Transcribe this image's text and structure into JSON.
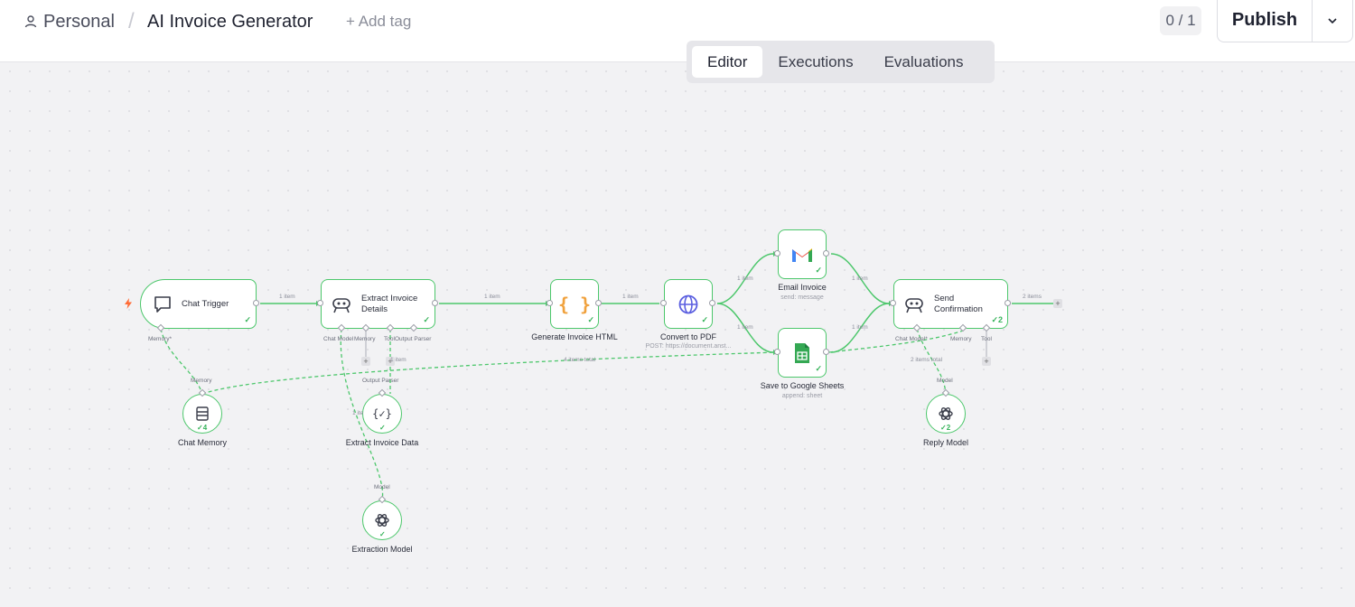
{
  "header": {
    "workspace": "Personal",
    "separator": "/",
    "workflow_name": "AI Invoice Generator",
    "add_tag": "+ Add tag",
    "counter": "0 / 1",
    "publish_label": "Publish"
  },
  "tabs": [
    {
      "label": "Editor",
      "active": true
    },
    {
      "label": "Executions",
      "active": false
    },
    {
      "label": "Evaluations",
      "active": false
    }
  ],
  "nodes": {
    "chat_trigger": {
      "title": "Chat Trigger"
    },
    "extract_invoice_details": {
      "title": "Extract Invoice Details",
      "line1": "Extract Invoice",
      "line2": "Details"
    },
    "generate_invoice_html": {
      "title": "Generate Invoice HTML"
    },
    "convert_to_pdf": {
      "title": "Convert to PDF",
      "subtitle": "POST: https://document.anst..."
    },
    "email_invoice": {
      "title": "Email Invoice",
      "subtitle": "send: message"
    },
    "save_to_google_sheets": {
      "title": "Save to Google Sheets",
      "subtitle": "append: sheet"
    },
    "send_confirmation": {
      "title": "Send Confirmation",
      "line1": "Send",
      "line2": "Confirmation",
      "badge": "2"
    },
    "chat_memory": {
      "title": "Chat Memory",
      "badge": "4"
    },
    "extract_invoice_data": {
      "title": "Extract Invoice Data"
    },
    "extraction_model": {
      "title": "Extraction Model"
    },
    "reply_model": {
      "title": "Reply Model",
      "badge": "2"
    }
  },
  "ports": {
    "memory_star": "Memory*",
    "chat_model": "Chat Model",
    "memory": "Memory",
    "tool": "Tool",
    "output_parser": "Output Parser",
    "chat_model_star": "Chat Model*",
    "memory2": "Memory",
    "tool2": "Tool",
    "in_memory": "Memory",
    "in_output_parser": "Output Parser",
    "in_model": "Model",
    "in_model2": "Model"
  },
  "edges": {
    "e1": "1 item",
    "e2": "1 item",
    "e3": "1 item",
    "e4": "1 item",
    "e5": "1 item",
    "e6": "1 item",
    "e7": "1 item",
    "e8": "2 items",
    "memory_total": "4 items total",
    "reply_total": "2 items total",
    "parser_item": "1 item",
    "model_item": "1 ite"
  },
  "colors": {
    "success": "#4cc76b",
    "trigger": "#ff6b35",
    "gmail_red": "#ea4335",
    "sheets_green": "#34a853",
    "code_orange": "#f0a13c",
    "globe_blue": "#5b5fe0"
  }
}
